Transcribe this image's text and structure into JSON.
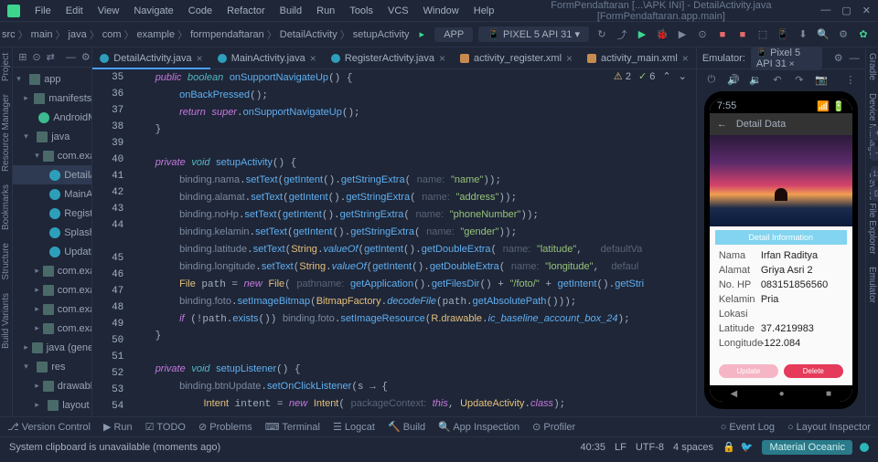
{
  "menu": {
    "items": [
      "File",
      "Edit",
      "View",
      "Navigate",
      "Code",
      "Refactor",
      "Build",
      "Run",
      "Tools",
      "VCS",
      "Window",
      "Help"
    ],
    "path": "FormPendaftaran [...\\APK INI] - DetailActivity.java [FormPendaftaran.app.main]"
  },
  "breadcrumbs": [
    "src",
    "main",
    "java",
    "com",
    "example",
    "formpendaftaran",
    "DetailActivity",
    "setupActivity"
  ],
  "config_app": "APP",
  "config_device": "PIXEL 5 API 31",
  "tree": [
    {
      "d": 0,
      "exp": "▾",
      "icon": "folder",
      "lbl": "app"
    },
    {
      "d": 1,
      "exp": "▸",
      "icon": "folder",
      "lbl": "manifests"
    },
    {
      "d": 2,
      "exp": "",
      "icon": "green",
      "lbl": "AndroidMani"
    },
    {
      "d": 1,
      "exp": "▾",
      "icon": "folder",
      "lbl": "java"
    },
    {
      "d": 2,
      "exp": "▾",
      "icon": "folder",
      "lbl": "com.example"
    },
    {
      "d": 3,
      "exp": "",
      "icon": "class",
      "lbl": "DetailActi",
      "sel": true
    },
    {
      "d": 3,
      "exp": "",
      "icon": "class",
      "lbl": "MainActiv"
    },
    {
      "d": 3,
      "exp": "",
      "icon": "class",
      "lbl": "RegisterA"
    },
    {
      "d": 3,
      "exp": "",
      "icon": "class",
      "lbl": "SplashScr"
    },
    {
      "d": 3,
      "exp": "",
      "icon": "class",
      "lbl": "UpdateAc"
    },
    {
      "d": 2,
      "exp": "▸",
      "icon": "folder",
      "lbl": "com.example"
    },
    {
      "d": 2,
      "exp": "▸",
      "icon": "folder",
      "lbl": "com.example"
    },
    {
      "d": 2,
      "exp": "▸",
      "icon": "folder",
      "lbl": "com.example"
    },
    {
      "d": 2,
      "exp": "▸",
      "icon": "folder",
      "lbl": "com.example"
    },
    {
      "d": 1,
      "exp": "▸",
      "icon": "folder",
      "lbl": "java (generated)"
    },
    {
      "d": 1,
      "exp": "▾",
      "icon": "folder",
      "lbl": "res"
    },
    {
      "d": 2,
      "exp": "▸",
      "icon": "folder",
      "lbl": "drawable"
    },
    {
      "d": 2,
      "exp": "▸",
      "icon": "folder",
      "lbl": "layout"
    }
  ],
  "tabs": [
    {
      "lbl": "DetailActivity.java",
      "icon": "dot",
      "active": true
    },
    {
      "lbl": "MainActivity.java",
      "icon": "dot"
    },
    {
      "lbl": "RegisterActivity.java",
      "icon": "dot"
    },
    {
      "lbl": "activity_register.xml",
      "icon": "xml"
    },
    {
      "lbl": "activity_main.xml",
      "icon": "xml"
    }
  ],
  "gutter": [
    "35",
    "36",
    "37",
    "38",
    "39",
    "40",
    "41",
    "42",
    "43",
    "44",
    "",
    "45",
    "46",
    "47",
    "48",
    "49",
    "50",
    "51",
    "52",
    "53",
    "54"
  ],
  "warn": "2",
  "ok": "6",
  "emu": {
    "title": "Emulator:",
    "device": "Pixel 5 API 31",
    "status_time": "7:55",
    "app_title": "Detail Data",
    "info": "Detail Information",
    "rows": [
      [
        "Nama",
        "Irfan Raditya"
      ],
      [
        "Alamat",
        "Griya Asri 2"
      ],
      [
        "No. HP",
        "083151856560"
      ],
      [
        "Kelamin",
        "Pria"
      ],
      [
        "Lokasi",
        ""
      ],
      [
        "Latitude",
        "37.4219983"
      ],
      [
        "Longitude",
        "-122.084"
      ]
    ],
    "btn_update": "Update",
    "btn_delete": "Delete",
    "ratio": "1:1"
  },
  "bottom": {
    "items": [
      "Version Control",
      "Run",
      "TODO",
      "Problems",
      "Terminal",
      "Logcat",
      "Build",
      "App Inspection",
      "Profiler"
    ],
    "right": [
      "Event Log",
      "Layout Inspector"
    ]
  },
  "status": {
    "msg": "System clipboard is unavailable (moments ago)",
    "pos": "40:35",
    "lf": "LF",
    "enc": "UTF-8",
    "indent": "4 spaces",
    "theme": "Material Oceanic"
  },
  "left_rail": [
    "Project",
    "Resource Manager",
    "Bookmarks",
    "Structure",
    "Build Variants"
  ],
  "right_rail": [
    "Gradle",
    "Device Manager",
    "Device File Explorer",
    "Emulator"
  ]
}
